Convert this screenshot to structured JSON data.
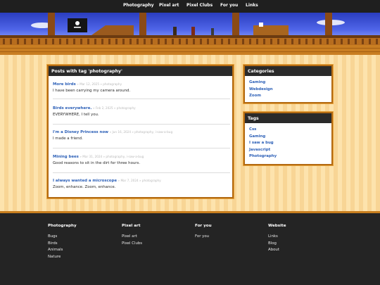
{
  "nav": {
    "items": [
      "Photography",
      "Pixel art",
      "Pixel Clubs",
      "For you",
      "Links"
    ]
  },
  "banner": {
    "icon": "pirate-ship-scene"
  },
  "posts_panel": {
    "title": "Posts with tag 'photography'",
    "posts": [
      {
        "title": "More birds",
        "meta": "» Mar 12, 2025 » photography",
        "text": "I have been carrying my camera around."
      },
      {
        "title": "Birds everywhere.",
        "meta": "» Feb 2, 2025 » photography",
        "text": "EVERYWHERE, I tell you."
      },
      {
        "title": "I'm a Disney Princess now",
        "meta": "» Jun 16, 2024 » photography, i-saw-a-bug",
        "text": "I made a friend."
      },
      {
        "title": "Mining bees",
        "meta": "» Mar 31, 2024 » photography, i-saw-a-bug",
        "text": "Good reasons to sit in the dirt for three hours."
      },
      {
        "title": "I always wanted a microscope",
        "meta": "» Mar 7, 2024 » photography",
        "text": "Zoom, enhance. Zoom, enhance."
      }
    ]
  },
  "categories_panel": {
    "title": "Categories",
    "items": [
      "Gaming",
      "Webdesign",
      "Zoom"
    ]
  },
  "tags_panel": {
    "title": "Tags",
    "items": [
      "Css",
      "Gaming",
      "I saw a bug",
      "Javascript",
      "Photography"
    ]
  },
  "footer": {
    "columns": [
      {
        "title": "Photography",
        "links": [
          "Bugs",
          "Birds",
          "Animals",
          "Nature"
        ]
      },
      {
        "title": "Pixel art",
        "links": [
          "Pixel art",
          "Pixel Clubs"
        ]
      },
      {
        "title": "For you",
        "links": [
          "For you"
        ]
      },
      {
        "title": "Website",
        "links": [
          "Links",
          "Blog",
          "About"
        ]
      }
    ]
  },
  "colors": {
    "accent_link": "#2b5fb7",
    "panel_border": "#b36a12",
    "panel_head": "#2a2a2a",
    "stripe_light": "#fde3ad",
    "stripe_dark": "#f8d595",
    "footer_bg": "#242424"
  }
}
